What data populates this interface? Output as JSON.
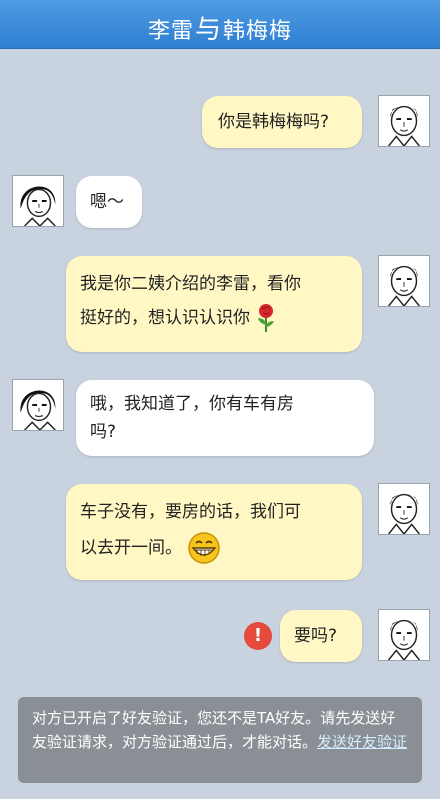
{
  "header": {
    "name_a": "李雷",
    "joiner": "与",
    "name_b": "韩梅梅"
  },
  "messages": [
    {
      "side": "right",
      "text": "你是韩梅梅吗?"
    },
    {
      "side": "left",
      "text": "嗯～"
    },
    {
      "side": "right",
      "line1": "我是你二姨介绍的李雷，看你",
      "line2": "挺好的，想认识认识你",
      "emoji": "rose-emoji"
    },
    {
      "side": "left",
      "line1": "哦，我知道了，你有车有房",
      "line2": "吗?"
    },
    {
      "side": "right",
      "line1": "车子没有，要房的话，我们可",
      "line2": "以去开一间。",
      "emoji": "grin-emoji"
    },
    {
      "side": "right",
      "text": "要吗?",
      "status": "!"
    }
  ],
  "notice": {
    "text": "对方已开启了好友验证，您还不是TA好友。请先发送好友验证请求，对方验证通过后，才能对话。",
    "link": "发送好友验证"
  },
  "colors": {
    "header": "#3b8ad8",
    "bubble_right": "#fff8c4",
    "bubble_left": "#ffffff",
    "alert": "#e44b3d",
    "background": "#c9d3df"
  }
}
